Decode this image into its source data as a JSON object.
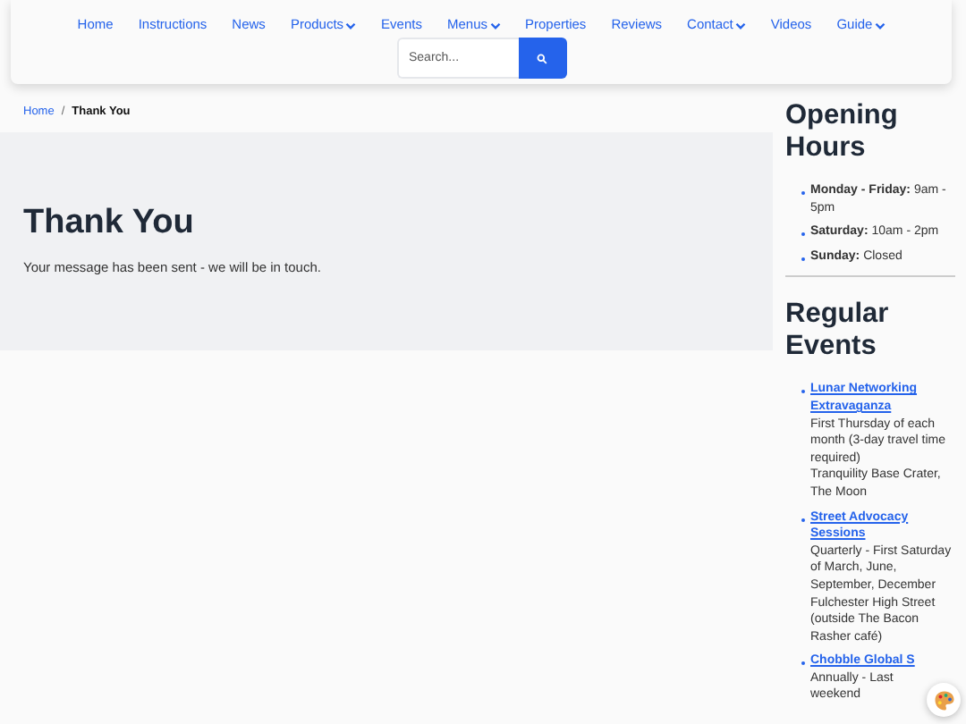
{
  "nav": {
    "items": [
      {
        "label": "Home",
        "has_menu": false
      },
      {
        "label": "Instructions",
        "has_menu": false
      },
      {
        "label": "News",
        "has_menu": false
      },
      {
        "label": "Products",
        "has_menu": true
      },
      {
        "label": "Events",
        "has_menu": false
      },
      {
        "label": "Menus",
        "has_menu": true
      },
      {
        "label": "Properties",
        "has_menu": false
      },
      {
        "label": "Reviews",
        "has_menu": false
      },
      {
        "label": "Contact",
        "has_menu": true
      },
      {
        "label": "Videos",
        "has_menu": false
      },
      {
        "label": "Guide",
        "has_menu": true
      }
    ],
    "search": {
      "placeholder": "Search..."
    }
  },
  "breadcrumb_separator": "/",
  "breadcrumb": [
    {
      "label": "Home",
      "current": false
    },
    {
      "label": "Thank You",
      "current": true
    }
  ],
  "main": {
    "title": "Thank You",
    "message": "Your message has been sent - we will be in touch."
  },
  "sidebar": {
    "hours": {
      "title": "Opening Hours",
      "items": [
        "**Monday - Friday:** 9am - 5pm",
        "**Saturday:** 10am - 2pm",
        "**Sunday:** Closed"
      ]
    },
    "events": {
      "title": "Regular Events",
      "items": [
        {
          "name": "Lunar Networking Extravaganza",
          "lines": [
            "First Thursday of each month (3-day travel time required)",
            "Tranquility Base Crater, The Moon"
          ]
        },
        {
          "name": "Street Advocacy Sessions",
          "lines": [
            "Quarterly - First Saturday of March, June, September, December",
            "Fulchester High Street (outside The Bacon Rasher café)"
          ]
        },
        {
          "name": "Chobble Global S",
          "lines": [
            "Annually - Last weekend"
          ]
        }
      ]
    }
  }
}
